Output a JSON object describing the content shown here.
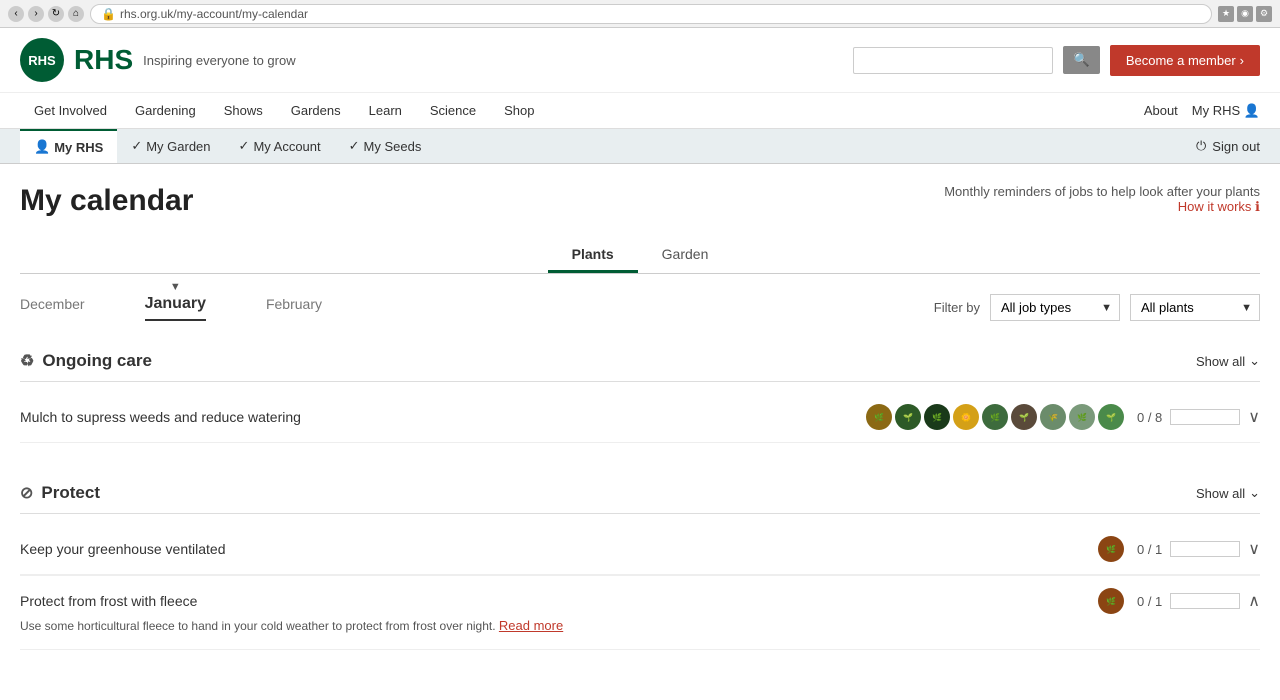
{
  "browser": {
    "url": "rhs.org.uk/my-account/my-calendar"
  },
  "header": {
    "logo_text": "RHS",
    "tagline": "Inspiring everyone to grow",
    "search_placeholder": "",
    "member_btn": "Become a member"
  },
  "main_nav": {
    "items": [
      {
        "label": "Get Involved"
      },
      {
        "label": "Gardening"
      },
      {
        "label": "Shows"
      },
      {
        "label": "Gardens"
      },
      {
        "label": "Learn"
      },
      {
        "label": "Science"
      },
      {
        "label": "Shop"
      }
    ],
    "right_items": [
      {
        "label": "About"
      },
      {
        "label": "My RHS"
      }
    ]
  },
  "sub_nav": {
    "items": [
      {
        "label": "My RHS",
        "active": true
      },
      {
        "label": "My Garden",
        "active": false
      },
      {
        "label": "My Account",
        "active": false
      },
      {
        "label": "My Seeds",
        "active": false
      }
    ],
    "sign_out": "Sign out"
  },
  "page": {
    "title": "My calendar",
    "subtitle": "Monthly reminders of jobs to help look after your plants",
    "how_it_works": "How it works"
  },
  "tabs": [
    {
      "label": "Plants",
      "active": true
    },
    {
      "label": "Garden",
      "active": false
    }
  ],
  "months": [
    {
      "label": "December",
      "active": false
    },
    {
      "label": "January",
      "active": true
    },
    {
      "label": "February",
      "active": false
    }
  ],
  "filter": {
    "label": "Filter by",
    "job_types": "All job types",
    "plants": "All plants"
  },
  "sections": [
    {
      "id": "ongoing-care",
      "icon": "♻",
      "title": "Ongoing care",
      "show_all": "Show all",
      "tasks": [
        {
          "label": "Mulch to supress weeds and reduce watering",
          "count": "0 / 8",
          "avatars": 9,
          "chevron": "down"
        }
      ]
    },
    {
      "id": "protect",
      "icon": "⊘",
      "title": "Protect",
      "show_all": "Show all",
      "tasks": [
        {
          "label": "Keep your greenhouse ventilated",
          "count": "0 / 1",
          "avatars": 1,
          "chevron": "down"
        },
        {
          "label": "Protect from frost with fleece",
          "count": "0 / 1",
          "avatars": 1,
          "chevron": "up",
          "sub_text": "Use some horticultural fleece to hand in your cold weather to protect from frost over night.",
          "read_more": "Read more"
        }
      ]
    }
  ]
}
